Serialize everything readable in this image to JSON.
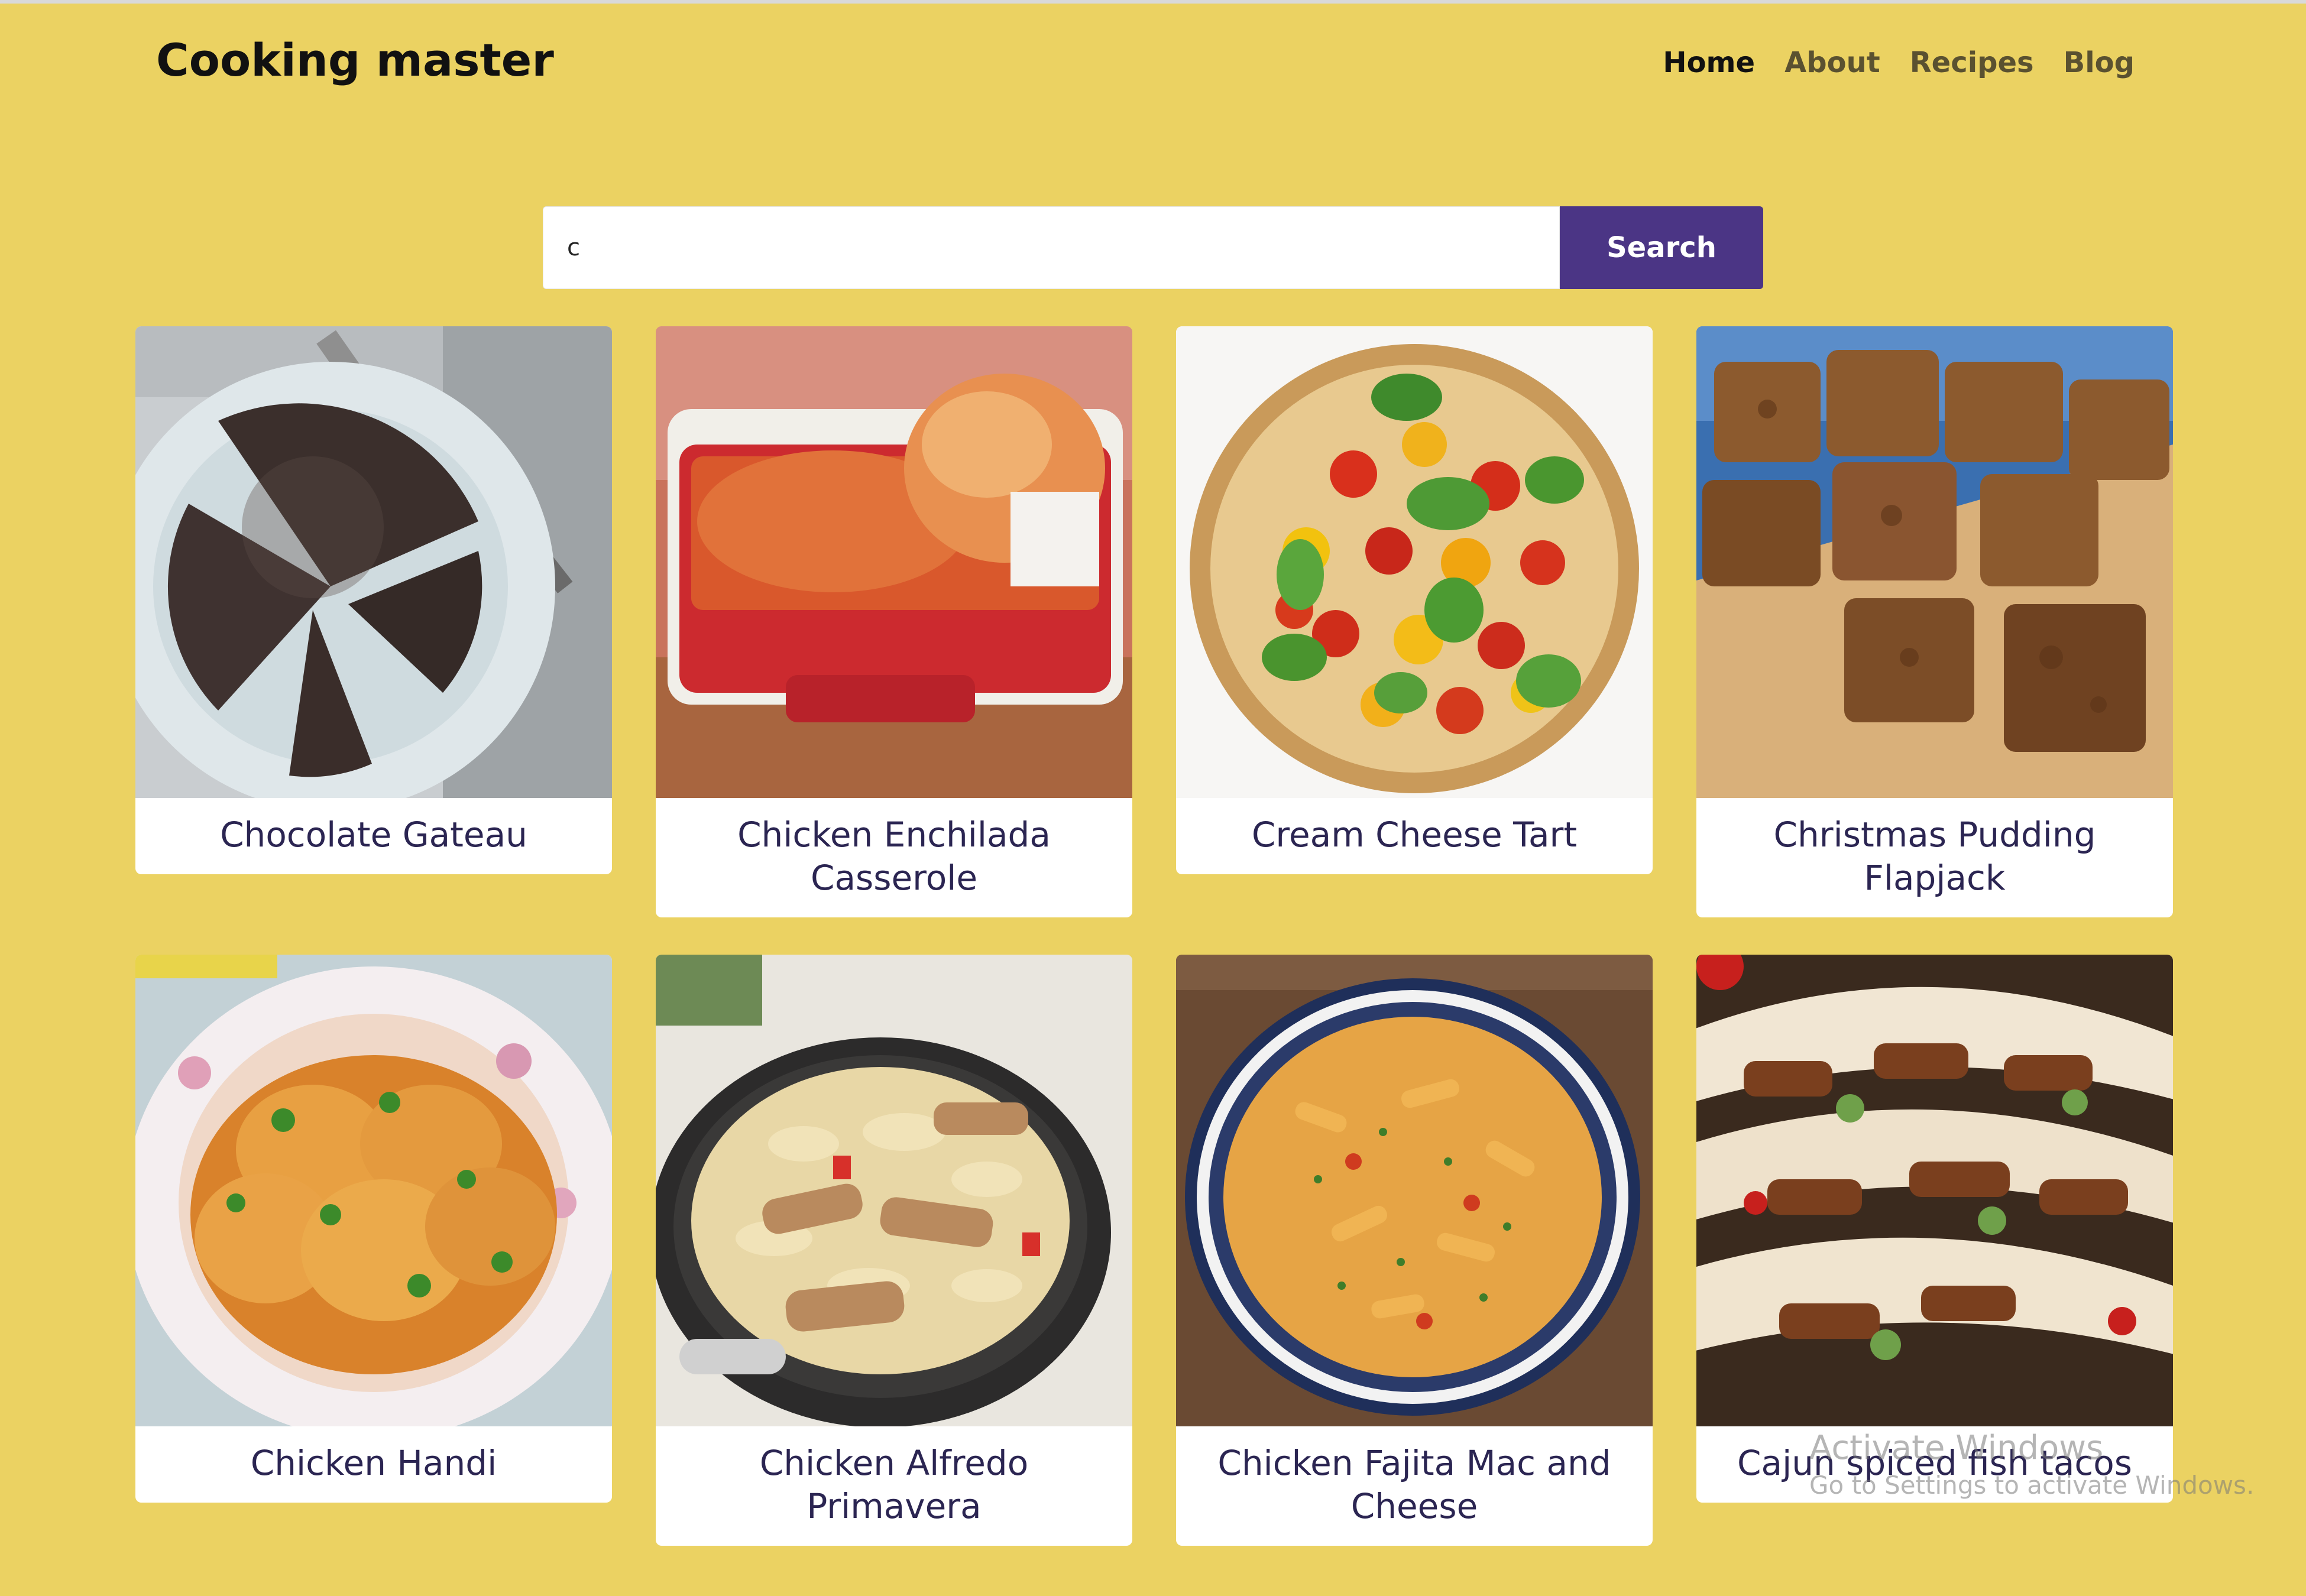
{
  "app": {
    "brand": "Cooking master",
    "nav": [
      {
        "label": "Home",
        "active": true
      },
      {
        "label": "About",
        "active": false
      },
      {
        "label": "Recipes",
        "active": false
      },
      {
        "label": "Blog",
        "active": false
      }
    ]
  },
  "search": {
    "value": "c",
    "button_label": "Search"
  },
  "recipes": [
    {
      "title": "Chocolate Gateau"
    },
    {
      "title": "Chicken Enchilada Casserole"
    },
    {
      "title": "Cream Cheese Tart"
    },
    {
      "title": "Christmas Pudding Flapjack"
    },
    {
      "title": "Chicken Handi"
    },
    {
      "title": "Chicken Alfredo Primavera"
    },
    {
      "title": "Chicken Fajita Mac and Cheese"
    },
    {
      "title": "Cajun spiced fish tacos"
    }
  ],
  "system": {
    "activation_title": "Activate Windows",
    "activation_subtitle": "Go to Settings to activate Windows."
  },
  "colors": {
    "page_background": "#EBD262",
    "accent": "#4B3585",
    "card_title": "#2b2552"
  }
}
